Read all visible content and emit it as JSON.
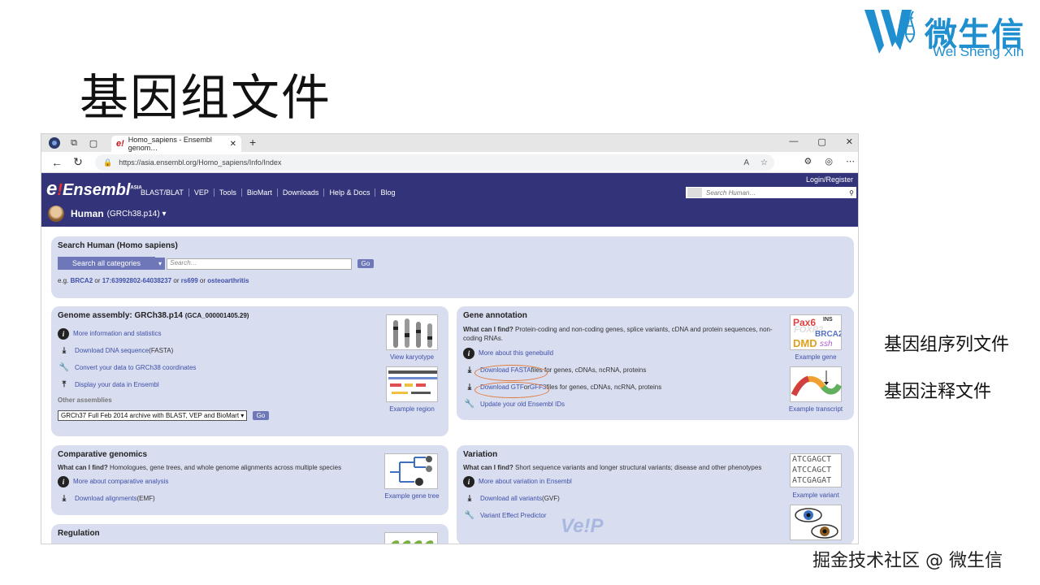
{
  "brand": {
    "name_cn": "微生信",
    "name_en": "Wei Sheng Xin",
    "accent": "#1f8fd0"
  },
  "slide_title": "基因组文件",
  "notes": [
    "基因组序列文件",
    "基因注释文件"
  ],
  "watermark": "掘金技术社区 @ 微生信",
  "browser": {
    "tab_title": "Homo_sapiens - Ensembl genom…",
    "url": "https://asia.ensembl.org/Homo_sapiens/Info/Index"
  },
  "ensembl": {
    "logo": "Ensembl",
    "logo_sup": "ASIA",
    "nav": [
      "BLAST/BLAT",
      "VEP",
      "Tools",
      "BioMart",
      "Downloads",
      "Help & Docs",
      "Blog"
    ],
    "login": "Login/Register",
    "search_placeholder": "Search Human…",
    "species": "Human",
    "assembly": "(GRCh38.p14) ▾",
    "header_color": "#33337a"
  },
  "search_panel": {
    "title": "Search Human (Homo sapiens)",
    "category": "Search all categories",
    "placeholder": "Search…",
    "go": "Go",
    "eg": "e.g.",
    "ex1": "BRCA2",
    "or1": "or",
    "ex2": "17:63992802-64038237",
    "or2": "or",
    "ex3": "rs699",
    "or3": "or",
    "ex4": "osteoarthritis"
  },
  "genome_panel": {
    "title": "Genome assembly: GRCh38.p14",
    "acc": "(GCA_000001405.29)",
    "links": [
      {
        "text": "More information and statistics",
        "icon": "info-icon"
      },
      {
        "text": "Download DNA sequence",
        "suffix": " (FASTA)",
        "icon": "download-icon"
      },
      {
        "text": "Convert your data to GRCh38 coordinates",
        "icon": "wrench-icon"
      },
      {
        "text": "Display your data in Ensembl",
        "icon": "upload-icon"
      }
    ],
    "other": "Other assemblies",
    "select": "GRCh37 Full Feb 2014 archive with BLAST, VEP and BioMart",
    "go": "Go",
    "thumb1": "View karyotype",
    "thumb2": "Example region"
  },
  "gene_panel": {
    "title": "Gene annotation",
    "q": "What can I find?",
    "desc": "Protein-coding and non-coding genes, splice variants, cDNA and protein sequences, non-coding RNAs.",
    "link1": "More about this genebuild",
    "fasta_link": "Download FASTA",
    "fasta_suffix": " files for genes, cDNAs, ncRNA, proteins",
    "gtf_link": "Download GTF",
    "gtf_or": " or ",
    "gff_link": "GFF3",
    "gtf_suffix": " files for genes, cDNAs, ncRNA, proteins",
    "link4": "Update your old Ensembl IDs",
    "thumb1": "Example gene",
    "thumb2": "Example transcript"
  },
  "comp_panel": {
    "title": "Comparative genomics",
    "q": "What can I find?",
    "desc": "Homologues, gene trees, and whole genome alignments across multiple species",
    "link1": "More about comparative analysis",
    "link2": "Download alignments",
    "link2_suffix": " (EMF)",
    "thumb": "Example gene tree"
  },
  "var_panel": {
    "title": "Variation",
    "q": "What can I find?",
    "desc": "Short sequence variants and longer structural variants; disease and other phenotypes",
    "link1": "More about variation in Ensembl",
    "link2": "Download all variants",
    "link2_suffix": " (GVF)",
    "link3": "Variant Effect Predictor",
    "vep_logo": "Ve!P",
    "thumb": "Example variant",
    "seq": [
      "ATCGAGCT",
      "ATCCAGCT",
      "ATCGAGAT"
    ]
  },
  "reg_panel": {
    "title": "Regulation"
  },
  "gene_thumb": {
    "l1": "Pax6",
    "l2": "INS",
    "l3": "FOXP2",
    "l4": "BRCA2",
    "l5": "DMD",
    "l6": "ssh"
  }
}
